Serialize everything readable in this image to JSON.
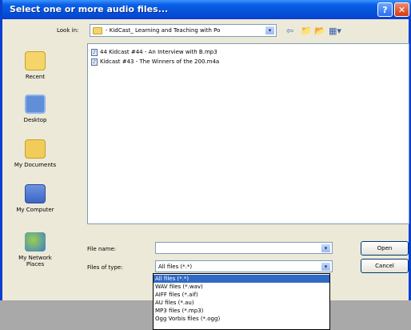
{
  "window": {
    "title": "Select one or more audio files...",
    "help_label": "?",
    "close_label": "✕"
  },
  "lookin": {
    "label": "Look in:",
    "value": "- KidCast_ Learning and Teaching with Po",
    "arrow": "▾"
  },
  "toolbar": {
    "back_icon": "⇦",
    "up_icon": "📁",
    "new_folder_icon": "📂",
    "view_icon": "▦▾"
  },
  "places": [
    {
      "label": "Recent"
    },
    {
      "label": "Desktop"
    },
    {
      "label": "My Documents"
    },
    {
      "label": "My Computer"
    },
    {
      "label": "My Network Places"
    }
  ],
  "files": [
    {
      "name": "44 Kidcast #44 - An Interview with B.mp3",
      "icon": "♪"
    },
    {
      "name": "Kidcast #43 - The Winners of the 200.m4a",
      "icon": "♪"
    }
  ],
  "filename": {
    "label": "File name:",
    "value": "",
    "arrow": "▾"
  },
  "filetype": {
    "label": "Files of type:",
    "value": "All files (*.*)",
    "arrow": "▾",
    "options": [
      "All files (*.*)",
      "WAV files (*.wav)",
      "AIFF files (*.aif)",
      "AU files (*.au)",
      "MP3 files (*.mp3)",
      "Ogg Vorbis files (*.ogg)"
    ],
    "selected_index": 0
  },
  "buttons": {
    "open": "Open",
    "cancel": "Cancel"
  }
}
